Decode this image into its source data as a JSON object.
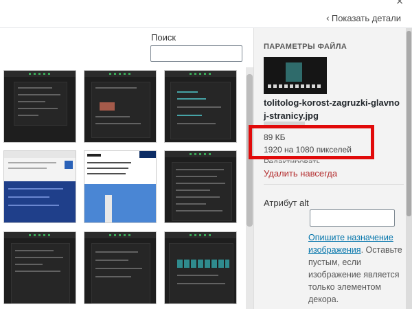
{
  "header": {
    "show_details_label": "Показать детали"
  },
  "search": {
    "label": "Поиск",
    "value": "",
    "placeholder": ""
  },
  "media_grid": {
    "items": [
      {
        "style": "dark"
      },
      {
        "style": "dark"
      },
      {
        "style": "dark"
      },
      {
        "style": "light-blue"
      },
      {
        "style": "news"
      },
      {
        "style": "dark"
      },
      {
        "style": "dark"
      },
      {
        "style": "dark"
      },
      {
        "style": "dark-teal"
      }
    ]
  },
  "sidebar": {
    "title": "ПАРАМЕТРЫ ФАЙЛА",
    "filename": "tolitolog-korost-zagruzki-glavnoj-stranicy.jpg",
    "filesize": "89 КБ",
    "dimensions": "1920 на 1080 пикселей",
    "edit_label": "Редактировать",
    "delete_label": "Удалить навсегда",
    "alt_label": "Атрибут alt",
    "alt_value": "",
    "alt_help_link": "Опишите назначение изображения",
    "alt_help_text": ". Оставьте пустым, если изображение является только элементом декора."
  },
  "colors": {
    "highlight": "#e10a0a",
    "link": "#0073aa",
    "delete": "#b32d2e"
  }
}
